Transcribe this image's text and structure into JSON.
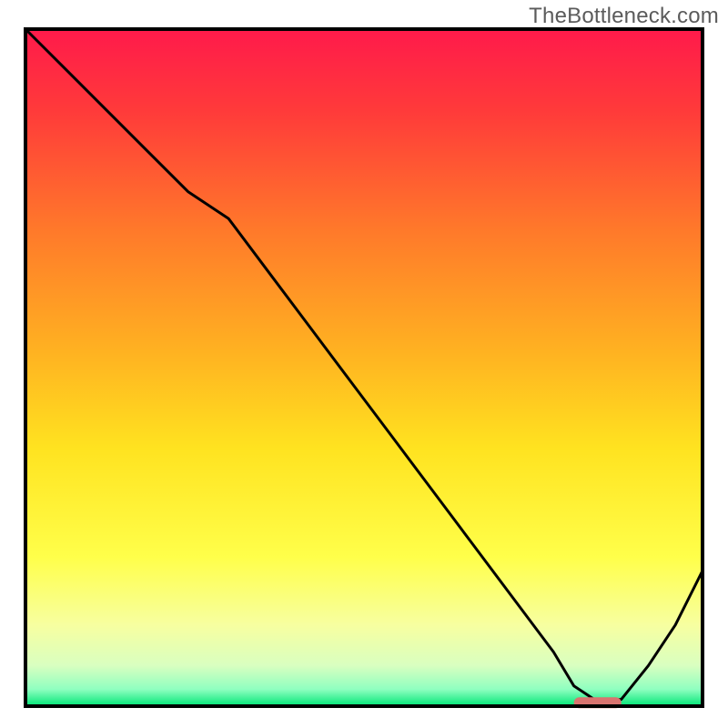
{
  "watermark": "TheBottleneck.com",
  "chart_data": {
    "type": "line",
    "title": "",
    "xlabel": "",
    "ylabel": "",
    "xlim": [
      0,
      100
    ],
    "ylim": [
      0,
      100
    ],
    "series": [
      {
        "name": "bottleneck-curve",
        "x": [
          0,
          6,
          12,
          18,
          24,
          30,
          36,
          42,
          48,
          54,
          60,
          66,
          72,
          78,
          81,
          84,
          88,
          92,
          96,
          100
        ],
        "y": [
          100,
          94,
          88,
          82,
          76,
          72,
          64,
          56,
          48,
          40,
          32,
          24,
          16,
          8,
          3,
          1,
          1,
          6,
          12,
          20
        ]
      }
    ],
    "marker": {
      "name": "optimal-zone",
      "x_start": 81,
      "x_end": 88,
      "y": 0.5,
      "color": "#d9736f"
    },
    "axes": {
      "visible": false
    },
    "background": {
      "type": "vertical-gradient",
      "stops": [
        {
          "offset": 0.0,
          "color": "#ff1a4b"
        },
        {
          "offset": 0.12,
          "color": "#ff3a3a"
        },
        {
          "offset": 0.3,
          "color": "#ff7a2a"
        },
        {
          "offset": 0.48,
          "color": "#ffb321"
        },
        {
          "offset": 0.62,
          "color": "#ffe320"
        },
        {
          "offset": 0.78,
          "color": "#ffff4a"
        },
        {
          "offset": 0.88,
          "color": "#f7ffa0"
        },
        {
          "offset": 0.94,
          "color": "#d9ffc0"
        },
        {
          "offset": 0.975,
          "color": "#8fffc0"
        },
        {
          "offset": 1.0,
          "color": "#00e676"
        }
      ]
    },
    "frame_color": "#000000"
  }
}
